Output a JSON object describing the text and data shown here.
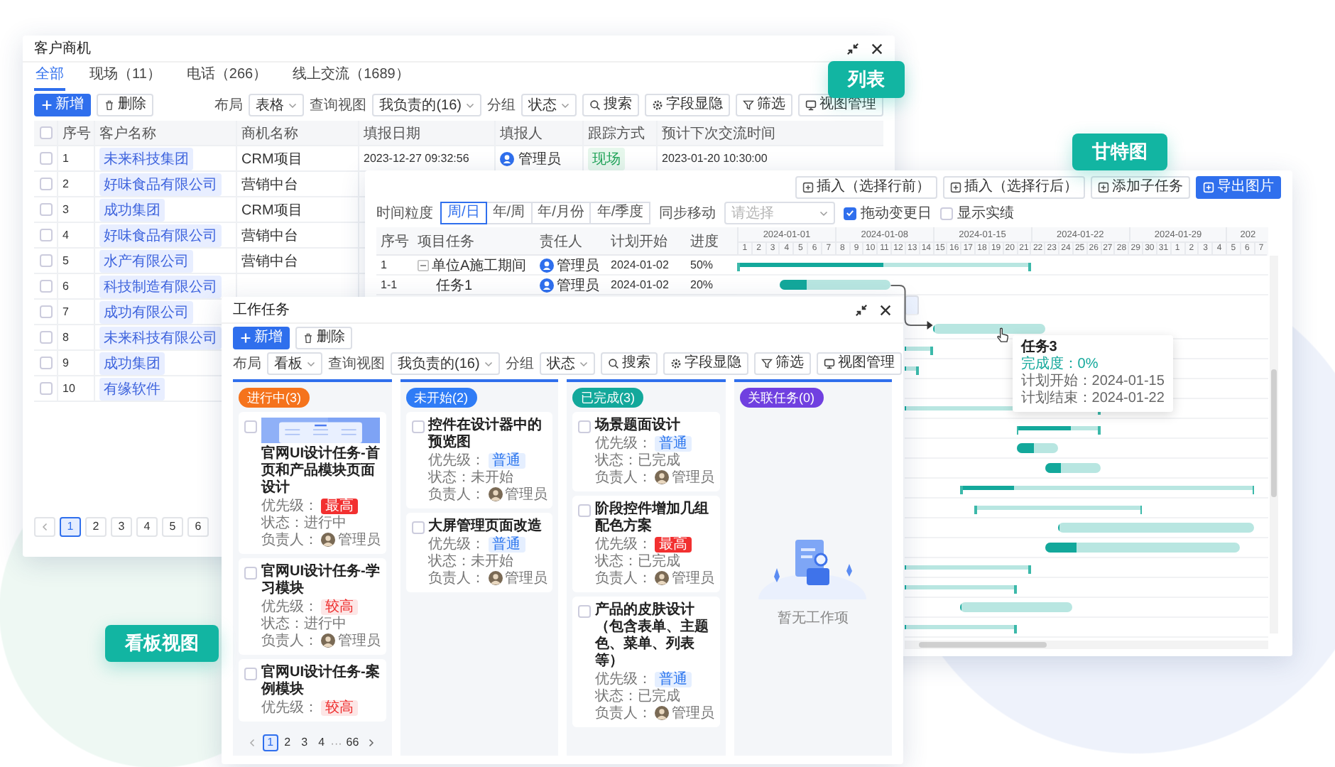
{
  "labels": [
    "列表",
    "甘特图",
    "看板视图"
  ],
  "list_window": {
    "title": "客户商机",
    "tabs": [
      {
        "label": "全部",
        "selected": true
      },
      {
        "label": "现场（11）",
        "selected": false
      },
      {
        "label": "电话（266）",
        "selected": false
      },
      {
        "label": "线上交流（1689）",
        "selected": false
      }
    ],
    "toolbar": {
      "add": "新增",
      "delete": "删除",
      "filters": [
        {
          "label": "布局",
          "value": "表格"
        },
        {
          "label": "查询视图",
          "value": "我负责的(16)"
        },
        {
          "label": "分组",
          "value": "状态"
        }
      ],
      "buttons": [
        {
          "kind": "search",
          "label": "搜索"
        },
        {
          "kind": "fields",
          "label": "字段显隐"
        },
        {
          "kind": "filter",
          "label": "筛选"
        },
        {
          "kind": "views",
          "label": "视图管理"
        }
      ]
    },
    "all_checked": false,
    "columns": [
      "序号",
      "客户名称",
      "商机名称",
      "填报日期",
      "填报人",
      "跟踪方式",
      "预计下次交流时间"
    ],
    "rows": [
      {
        "checked": false,
        "no": "1",
        "customer": "未来科技集团",
        "opportunity": "CRM项目",
        "date": "2023-12-27 09:32:56",
        "reporter": "管理员",
        "method": "现场",
        "next_time": "2023-01-20 10:30:00"
      },
      {
        "checked": false,
        "no": "2",
        "customer": "好味食品有限公司",
        "opportunity": "营销中台"
      },
      {
        "checked": false,
        "no": "3",
        "customer": "成功集团",
        "opportunity": "CRM项目"
      },
      {
        "checked": false,
        "no": "4",
        "customer": "好味食品有限公司",
        "opportunity": "营销中台"
      },
      {
        "checked": false,
        "no": "5",
        "customer": "水产有限公司",
        "opportunity": "营销中台"
      },
      {
        "checked": false,
        "no": "6",
        "customer": "科技制造有限公司"
      },
      {
        "checked": false,
        "no": "7",
        "customer": "成功有限公司"
      },
      {
        "checked": false,
        "no": "8",
        "customer": "未来科技有限公司"
      },
      {
        "checked": false,
        "no": "9",
        "customer": "成功集团"
      },
      {
        "checked": false,
        "no": "10",
        "customer": "有缘软件"
      }
    ],
    "pages": [
      {
        "label": "1",
        "selected": true
      },
      {
        "label": "2",
        "selected": false
      },
      {
        "label": "3",
        "selected": false
      },
      {
        "label": "4",
        "selected": false
      },
      {
        "label": "5",
        "selected": false
      },
      {
        "label": "6",
        "selected": false
      }
    ]
  },
  "gantt_window": {
    "actions": [
      {
        "label": "插入（选择行前）",
        "primary": false
      },
      {
        "label": "插入（选择行后）",
        "primary": false
      },
      {
        "label": "添加子任务",
        "primary": false
      },
      {
        "label": "导出图片",
        "primary": true
      }
    ],
    "scale_label": "时间粒度",
    "scales": [
      {
        "label": "周/日",
        "selected": true
      },
      {
        "label": "年/周",
        "selected": false
      },
      {
        "label": "年/月份",
        "selected": false
      },
      {
        "label": "年/季度",
        "selected": false
      }
    ],
    "sync_label": "同步移动",
    "sync_placeholder": "请选择",
    "options": [
      {
        "label": "拖动变更日",
        "checked": true
      },
      {
        "label": "显示实绩",
        "checked": false
      }
    ],
    "columns": [
      "序号",
      "项目任务",
      "责任人",
      "计划开始",
      "进度"
    ],
    "rows": [
      {
        "no": "1",
        "task": "单位A施工期间",
        "expanded": true,
        "owner": "管理员",
        "start": "2024-01-02",
        "progress": "50%"
      },
      {
        "no": "1-1",
        "task": "任务1",
        "owner": "管理员",
        "start": "2024-01-02",
        "progress": "20%"
      }
    ],
    "weeks": [
      "2024-01-01",
      "2024-01-08",
      "2024-01-15",
      "2024-01-22",
      "2024-01-29",
      "202"
    ],
    "days": [
      "1",
      "2",
      "3",
      "4",
      "5",
      "6",
      "7",
      "8",
      "9",
      "10",
      "11",
      "12",
      "13",
      "14",
      "15",
      "16",
      "17",
      "18",
      "19",
      "20",
      "21",
      "22",
      "23",
      "24",
      "25",
      "26",
      "27",
      "28",
      "29",
      "30",
      "31",
      "1",
      "2",
      "3",
      "4",
      "5",
      "6",
      "7"
    ],
    "chart_rows": [
      {
        "selected": false,
        "bar": {
          "kind": "summary",
          "level": 0.5
        }
      },
      {
        "selected": false,
        "bar": {
          "kind": "task",
          "level": 0.25
        }
      },
      {
        "selected": true
      },
      {
        "selected": false,
        "bar": {
          "kind": "task",
          "level": 0,
          "tooltip": {
            "title": "任务3",
            "lines": [
              {
                "kind": "progress",
                "text": "完成度：0%"
              },
              {
                "kind": "plain",
                "text": "计划开始：2024-01-15"
              },
              {
                "kind": "plain",
                "text": "计划结束：2024-01-22"
              }
            ]
          }
        }
      },
      {
        "selected": false,
        "bar": {
          "kind": "summary",
          "level": 0
        }
      },
      {
        "selected": false,
        "bar": {
          "kind": "summary",
          "level": 0
        }
      },
      {
        "selected": false
      },
      {
        "selected": false,
        "bar": {
          "kind": "summary",
          "level": 0
        }
      },
      {
        "selected": false,
        "bar": {
          "kind": "summary",
          "level": 0.65
        }
      },
      {
        "selected": false,
        "bar": {
          "kind": "task",
          "level": 0.4
        }
      },
      {
        "selected": false,
        "bar": {
          "kind": "task",
          "level": 0.3
        }
      },
      {
        "selected": false,
        "bar": {
          "kind": "summary",
          "level": 0.18
        }
      },
      {
        "selected": false,
        "bar": {
          "kind": "summary",
          "level": 0
        }
      },
      {
        "selected": false,
        "bar": {
          "kind": "task",
          "level": 0
        }
      },
      {
        "selected": false,
        "bar": {
          "kind": "task",
          "level": 0.16
        }
      },
      {
        "selected": false,
        "bar": {
          "kind": "summary",
          "level": 0
        }
      },
      {
        "selected": false,
        "bar": {
          "kind": "summary",
          "level": 0
        }
      },
      {
        "selected": false,
        "bar": {
          "kind": "task",
          "level": 0
        }
      },
      {
        "selected": false,
        "bar": {
          "kind": "summary",
          "level": 0
        }
      }
    ]
  },
  "kanban_window": {
    "title": "工作任务",
    "toolbar": {
      "add": "新增",
      "delete": "删除",
      "filters": [
        {
          "label": "布局",
          "value": "看板"
        },
        {
          "label": "查询视图",
          "value": "我负责的(16)"
        },
        {
          "label": "分组",
          "value": "状态"
        }
      ],
      "buttons": [
        {
          "kind": "search",
          "label": "搜索"
        },
        {
          "kind": "fields",
          "label": "字段显隐"
        },
        {
          "kind": "filter",
          "label": "筛选"
        },
        {
          "kind": "views",
          "label": "视图管理"
        }
      ]
    },
    "columns": [
      {
        "title": "进行中(3)",
        "color": "#f5731c",
        "cards": [
          {
            "checked": false,
            "cover": true,
            "title": "官网UI设计任务-首页和产品模块页面设计",
            "priority_label": "优先级：",
            "priority": "最高",
            "color": "#f23030",
            "status": "状态：进行中",
            "owner_label": "负责人：",
            "owner": "管理员"
          },
          {
            "checked": false,
            "cover": false,
            "title": "官网UI设计任务-学习模块",
            "priority_label": "优先级：",
            "priority": "较高",
            "color": "#fde6e6",
            "status": "状态：进行中",
            "owner_label": "负责人：",
            "owner": "管理员"
          },
          {
            "checked": false,
            "cover": false,
            "title": "官网UI设计任务-案例模块",
            "priority_label": "优先级：",
            "priority": "较高",
            "color": "#fde6e6"
          }
        ],
        "pages": [
          {
            "kind": "page",
            "label": "1",
            "selected": true
          },
          {
            "kind": "page",
            "label": "2",
            "selected": false
          },
          {
            "kind": "page",
            "label": "3",
            "selected": false
          },
          {
            "kind": "page",
            "label": "4",
            "selected": false
          },
          {
            "kind": "ellipsis",
            "label": "···",
            "selected": false
          },
          {
            "kind": "page",
            "label": "66",
            "selected": false
          }
        ]
      },
      {
        "title": "未开始(2)",
        "color": "#2f7cf6",
        "cards": [
          {
            "checked": false,
            "cover": false,
            "title": "控件在设计器中的预览图",
            "priority_label": "优先级：",
            "priority": "普通",
            "color": "#e5efff",
            "status": "状态：未开始",
            "owner_label": "负责人：",
            "owner": "管理员"
          },
          {
            "checked": false,
            "cover": false,
            "title": "大屏管理页面改造",
            "priority_label": "优先级：",
            "priority": "普通",
            "color": "#e5efff",
            "status": "状态：未开始",
            "owner_label": "负责人：",
            "owner": "管理员"
          }
        ]
      },
      {
        "title": "已完成(3)",
        "color": "#13a89b",
        "cards": [
          {
            "checked": false,
            "cover": false,
            "title": "场景题面设计",
            "priority_label": "优先级：",
            "priority": "普通",
            "color": "#e5efff",
            "status": "状态：已完成",
            "owner_label": "负责人：",
            "owner": "管理员"
          },
          {
            "checked": false,
            "cover": false,
            "title": "阶段控件增加几组配色方案",
            "priority_label": "优先级：",
            "priority": "最高",
            "color": "#f23030",
            "status": "状态：已完成",
            "owner_label": "负责人：",
            "owner": "管理员"
          },
          {
            "checked": false,
            "cover": false,
            "title": "产品的皮肤设计（包含表单、主题色、菜单、列表等）",
            "priority_label": "优先级：",
            "priority": "普通",
            "color": "#e5efff",
            "status": "状态：已完成",
            "owner_label": "负责人：",
            "owner": "管理员"
          }
        ]
      },
      {
        "title": "关联任务(0)",
        "color": "#7040e0",
        "empty_text": "暂无工作项"
      }
    ]
  }
}
